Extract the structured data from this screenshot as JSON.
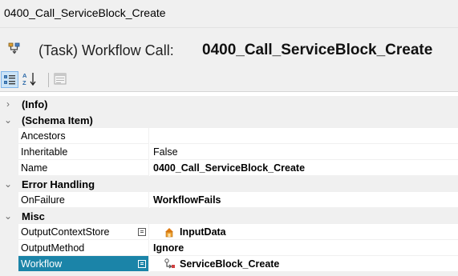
{
  "window": {
    "title": "0400_Call_ServiceBlock_Create"
  },
  "header": {
    "prefix": "(Task) Workflow Call:",
    "name": "0400_Call_ServiceBlock_Create",
    "icon": "workflow-call-icon"
  },
  "toolbar": {
    "buttons": [
      {
        "icon": "categorized-icon",
        "active": true
      },
      {
        "icon": "sort-alphabetical-icon",
        "active": false
      },
      {
        "icon": "property-pages-icon",
        "active": false,
        "disabled": true
      }
    ]
  },
  "grid": {
    "categories": [
      {
        "label": "(Info)",
        "expanded": false,
        "chevron": "›"
      },
      {
        "label": "(Schema Item)",
        "expanded": true,
        "chevron": "⌄",
        "props": [
          {
            "name": "Ancestors",
            "value": ""
          },
          {
            "name": "Inheritable",
            "value": "False"
          },
          {
            "name": "Name",
            "value": "0400_Call_ServiceBlock_Create",
            "bold": true
          }
        ]
      },
      {
        "label": "Error Handling",
        "expanded": true,
        "chevron": "⌄",
        "props": [
          {
            "name": "OnFailure",
            "value": "WorkflowFails",
            "bold": true
          }
        ]
      },
      {
        "label": "Misc",
        "expanded": true,
        "chevron": "⌄",
        "props": [
          {
            "name": "OutputContextStore",
            "value": "InputData",
            "bold": true,
            "icon": "context-store-icon",
            "button": true
          },
          {
            "name": "OutputMethod",
            "value": "Ignore",
            "bold": true
          },
          {
            "name": "Workflow",
            "value": "ServiceBlock_Create",
            "bold": true,
            "icon": "workflow-icon",
            "button": true,
            "selected": true
          }
        ]
      }
    ]
  },
  "colors": {
    "selection": "#1b84a8",
    "toolbar_active": "#cce4f7",
    "category_bg": "#f0f0f0"
  }
}
